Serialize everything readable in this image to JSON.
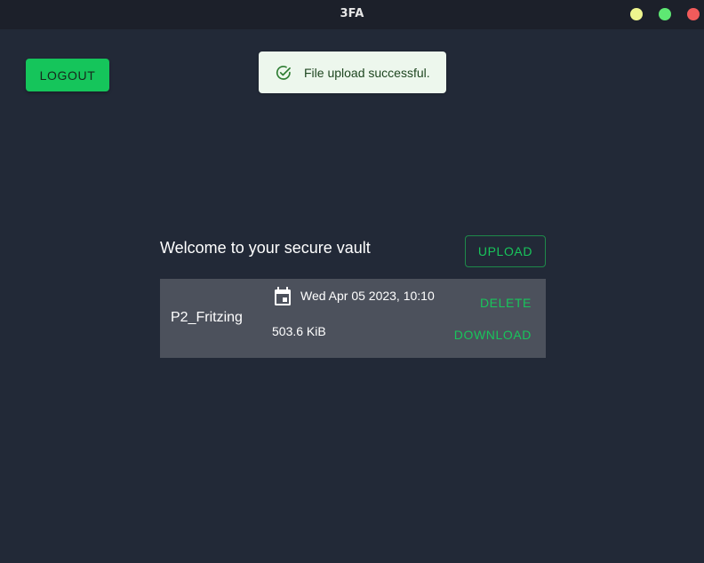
{
  "window": {
    "title": "3FA",
    "controls": {
      "minimize_color": "#eef58e",
      "maximize_color": "#5ee873",
      "close_color": "#f25b5b"
    }
  },
  "header": {
    "logout_label": "LOGOUT"
  },
  "toast": {
    "icon": "check-circle-icon",
    "message": "File upload successful."
  },
  "vault": {
    "title": "Welcome to your secure vault",
    "upload_label": "UPLOAD",
    "files": [
      {
        "name": "P2_Fritzing",
        "date_icon": "calendar-icon",
        "date": "Wed Apr 05 2023, 10:10",
        "size": "503.6 KiB",
        "delete_label": "DELETE",
        "download_label": "DOWNLOAD"
      }
    ]
  },
  "colors": {
    "background": "#222937",
    "accent": "#15c55b",
    "card": "#4c515c",
    "toast_background": "#edf7ed"
  }
}
